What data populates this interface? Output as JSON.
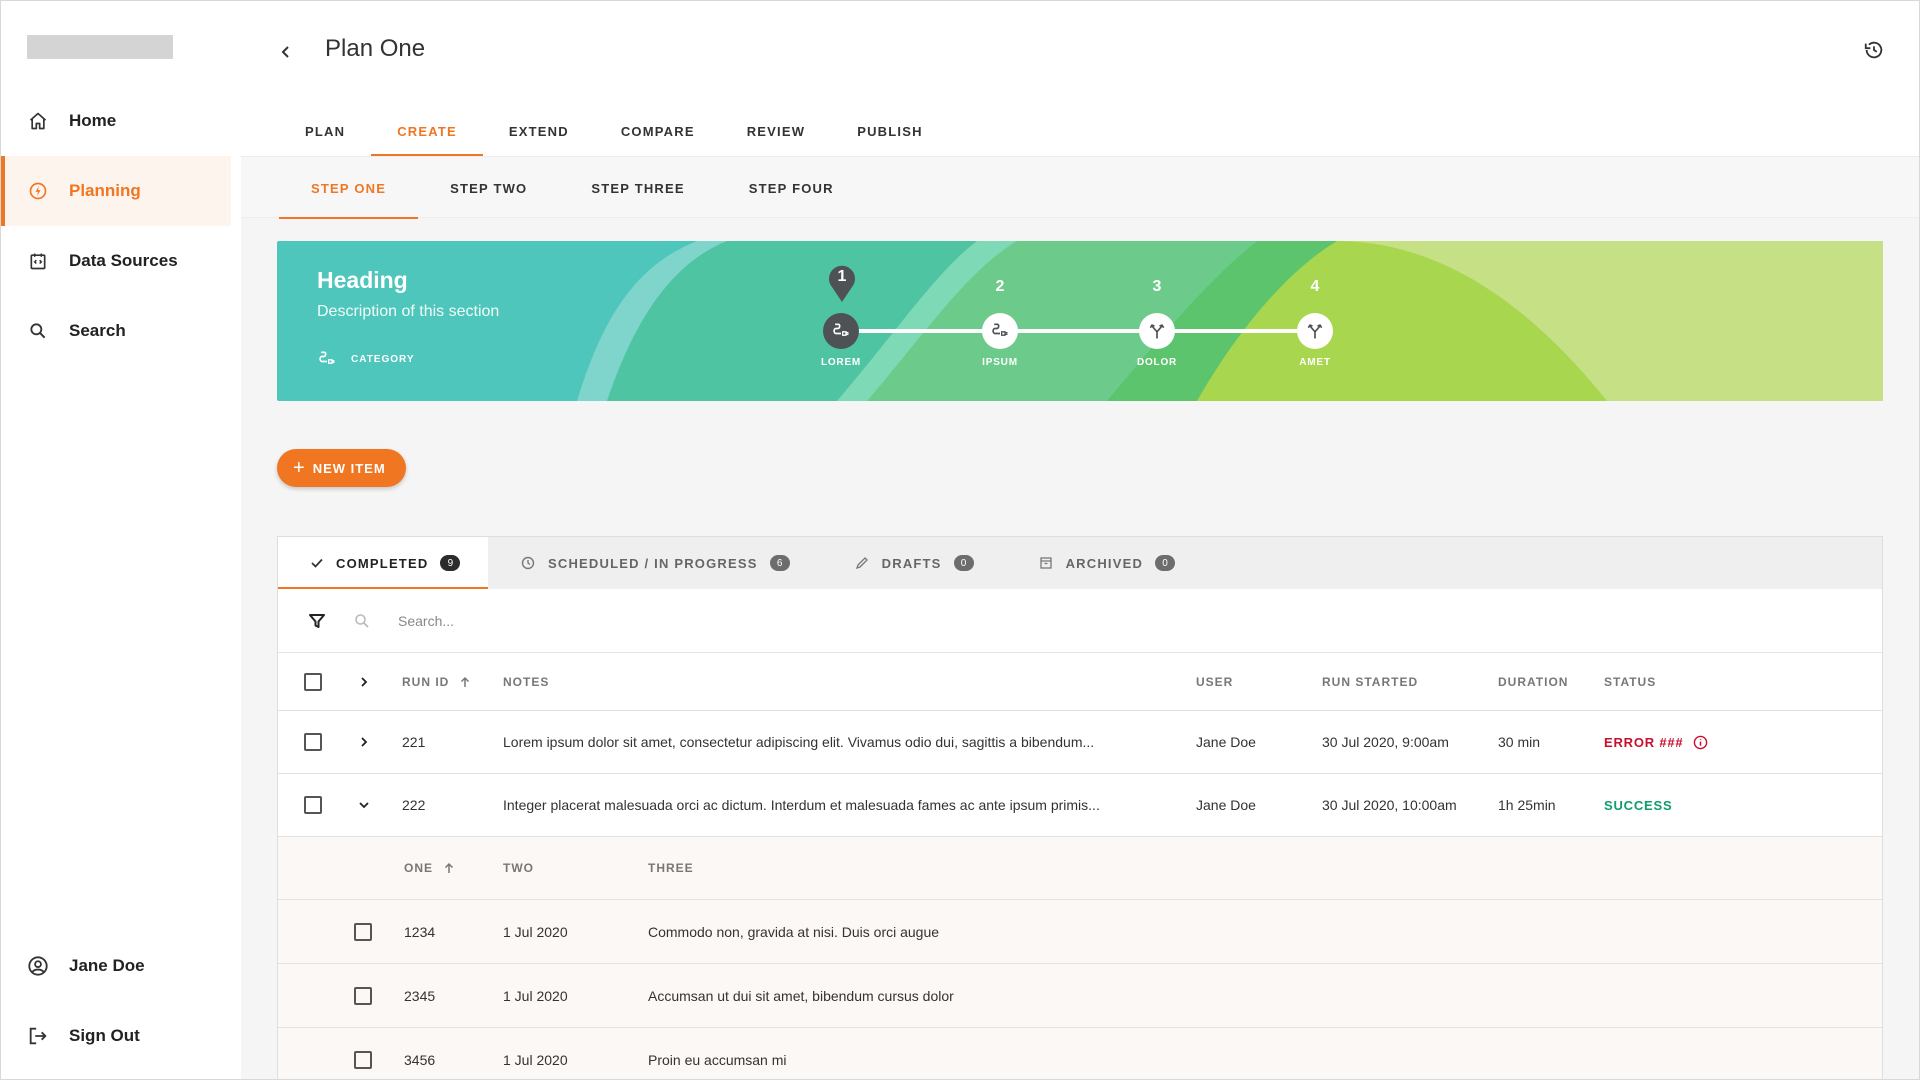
{
  "sidebar": {
    "items": [
      {
        "label": "Home",
        "icon": "home-icon"
      },
      {
        "label": "Planning",
        "icon": "planning-icon",
        "active": true
      },
      {
        "label": "Data Sources",
        "icon": "data-sources-icon"
      },
      {
        "label": "Search",
        "icon": "search-icon"
      }
    ],
    "user": {
      "label": "Jane Doe",
      "icon": "user-circle-icon"
    },
    "sign_out": {
      "label": "Sign Out",
      "icon": "sign-out-icon"
    }
  },
  "header": {
    "title": "Plan One",
    "tabs": [
      "PLAN",
      "CREATE",
      "EXTEND",
      "COMPARE",
      "REVIEW",
      "PUBLISH"
    ],
    "active_tab": "CREATE",
    "subtabs": [
      "STEP ONE",
      "STEP TWO",
      "STEP THREE",
      "STEP FOUR"
    ],
    "active_subtab": "STEP ONE"
  },
  "banner": {
    "heading": "Heading",
    "description": "Description of this section",
    "category": "CATEGORY",
    "steps": [
      {
        "num": "1",
        "label": "LOREM",
        "active": true
      },
      {
        "num": "2",
        "label": "IPSUM"
      },
      {
        "num": "3",
        "label": "DOLOR"
      },
      {
        "num": "4",
        "label": "AMET"
      }
    ]
  },
  "new_item": {
    "label": "NEW ITEM"
  },
  "status_tabs": [
    {
      "label": "COMPLETED",
      "count": "9",
      "icon": "check-icon",
      "active": true
    },
    {
      "label": "SCHEDULED / IN PROGRESS",
      "count": "6",
      "icon": "clock-icon"
    },
    {
      "label": "DRAFTS",
      "count": "0",
      "icon": "pencil-icon"
    },
    {
      "label": "ARCHIVED",
      "count": "0",
      "icon": "archive-icon"
    }
  ],
  "search": {
    "placeholder": "Search..."
  },
  "table": {
    "columns": {
      "run_id": "RUN ID",
      "notes": "NOTES",
      "user": "USER",
      "run_started": "RUN STARTED",
      "duration": "DURATION",
      "status": "STATUS"
    },
    "rows": [
      {
        "run_id": "221",
        "notes": "Lorem ipsum dolor sit amet, consectetur adipiscing elit. Vivamus odio dui, sagittis a bibendum...",
        "user": "Jane Doe",
        "run_started": "30 Jul 2020, 9:00am",
        "duration": "30 min",
        "status": "ERROR ###"
      },
      {
        "run_id": "222",
        "notes": "Integer placerat malesuada orci ac dictum. Interdum et malesuada fames ac ante ipsum primis...",
        "user": "Jane Doe",
        "run_started": "30 Jul 2020, 10:00am",
        "duration": "1h 25min",
        "status": "SUCCESS"
      }
    ],
    "subtable": {
      "columns": {
        "one": "ONE",
        "two": "TWO",
        "three": "THREE"
      },
      "rows": [
        {
          "one": "1234",
          "two": "1 Jul 2020",
          "three": "Commodo non, gravida at nisi. Duis orci augue"
        },
        {
          "one": "2345",
          "two": "1 Jul 2020",
          "three": "Accumsan ut dui sit amet, bibendum cursus dolor"
        },
        {
          "one": "3456",
          "two": "1 Jul 2020",
          "three": "Proin eu accumsan mi"
        }
      ]
    }
  },
  "colors": {
    "accent": "#f07622",
    "error": "#c8102e",
    "success": "#0f9d6a",
    "banner_teal": "#4dc5bb",
    "banner_green": "#b3d95a"
  }
}
